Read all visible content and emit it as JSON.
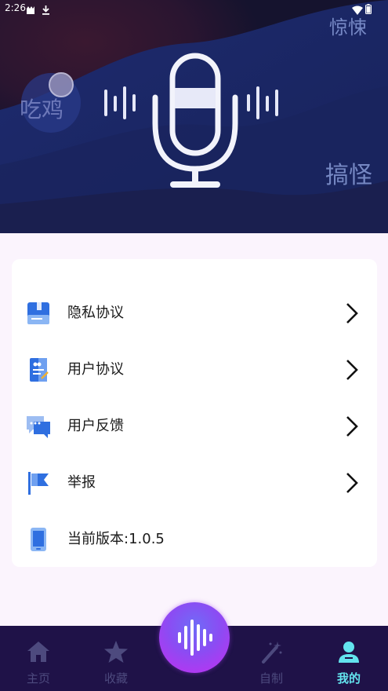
{
  "status_bar": {
    "time": "2:26",
    "icons": [
      "notification-icon",
      "download-icon",
      "wifi-icon",
      "battery-icon"
    ]
  },
  "hero": {
    "tags": [
      "惊悚",
      "吃鸡",
      "搞怪"
    ],
    "icon": "microphone-icon"
  },
  "menu": {
    "items": [
      {
        "label": "隐私协议",
        "icon": "privacy-book-icon",
        "has_arrow": true
      },
      {
        "label": "用户协议",
        "icon": "user-agreement-icon",
        "has_arrow": true
      },
      {
        "label": "用户反馈",
        "icon": "feedback-chat-icon",
        "has_arrow": true
      },
      {
        "label": "举报",
        "icon": "report-flag-icon",
        "has_arrow": true
      },
      {
        "label": "当前版本:1.0.5",
        "icon": "phone-icon",
        "has_arrow": false
      }
    ]
  },
  "bottom_nav": {
    "items": [
      {
        "label": "主页",
        "icon": "home-icon",
        "active": false
      },
      {
        "label": "收藏",
        "icon": "star-icon",
        "active": false
      },
      {
        "label": "自制",
        "icon": "magic-wand-icon",
        "active": false
      },
      {
        "label": "我的",
        "icon": "user-icon",
        "active": true
      }
    ],
    "center_icon": "sound-wave-icon"
  },
  "colors": {
    "nav_background": "#1f1248",
    "nav_active": "#63e4ee",
    "nav_inactive": "#4d4a7e",
    "hero_dark": "#15132e",
    "hero_blue": "#1c2a6e"
  }
}
